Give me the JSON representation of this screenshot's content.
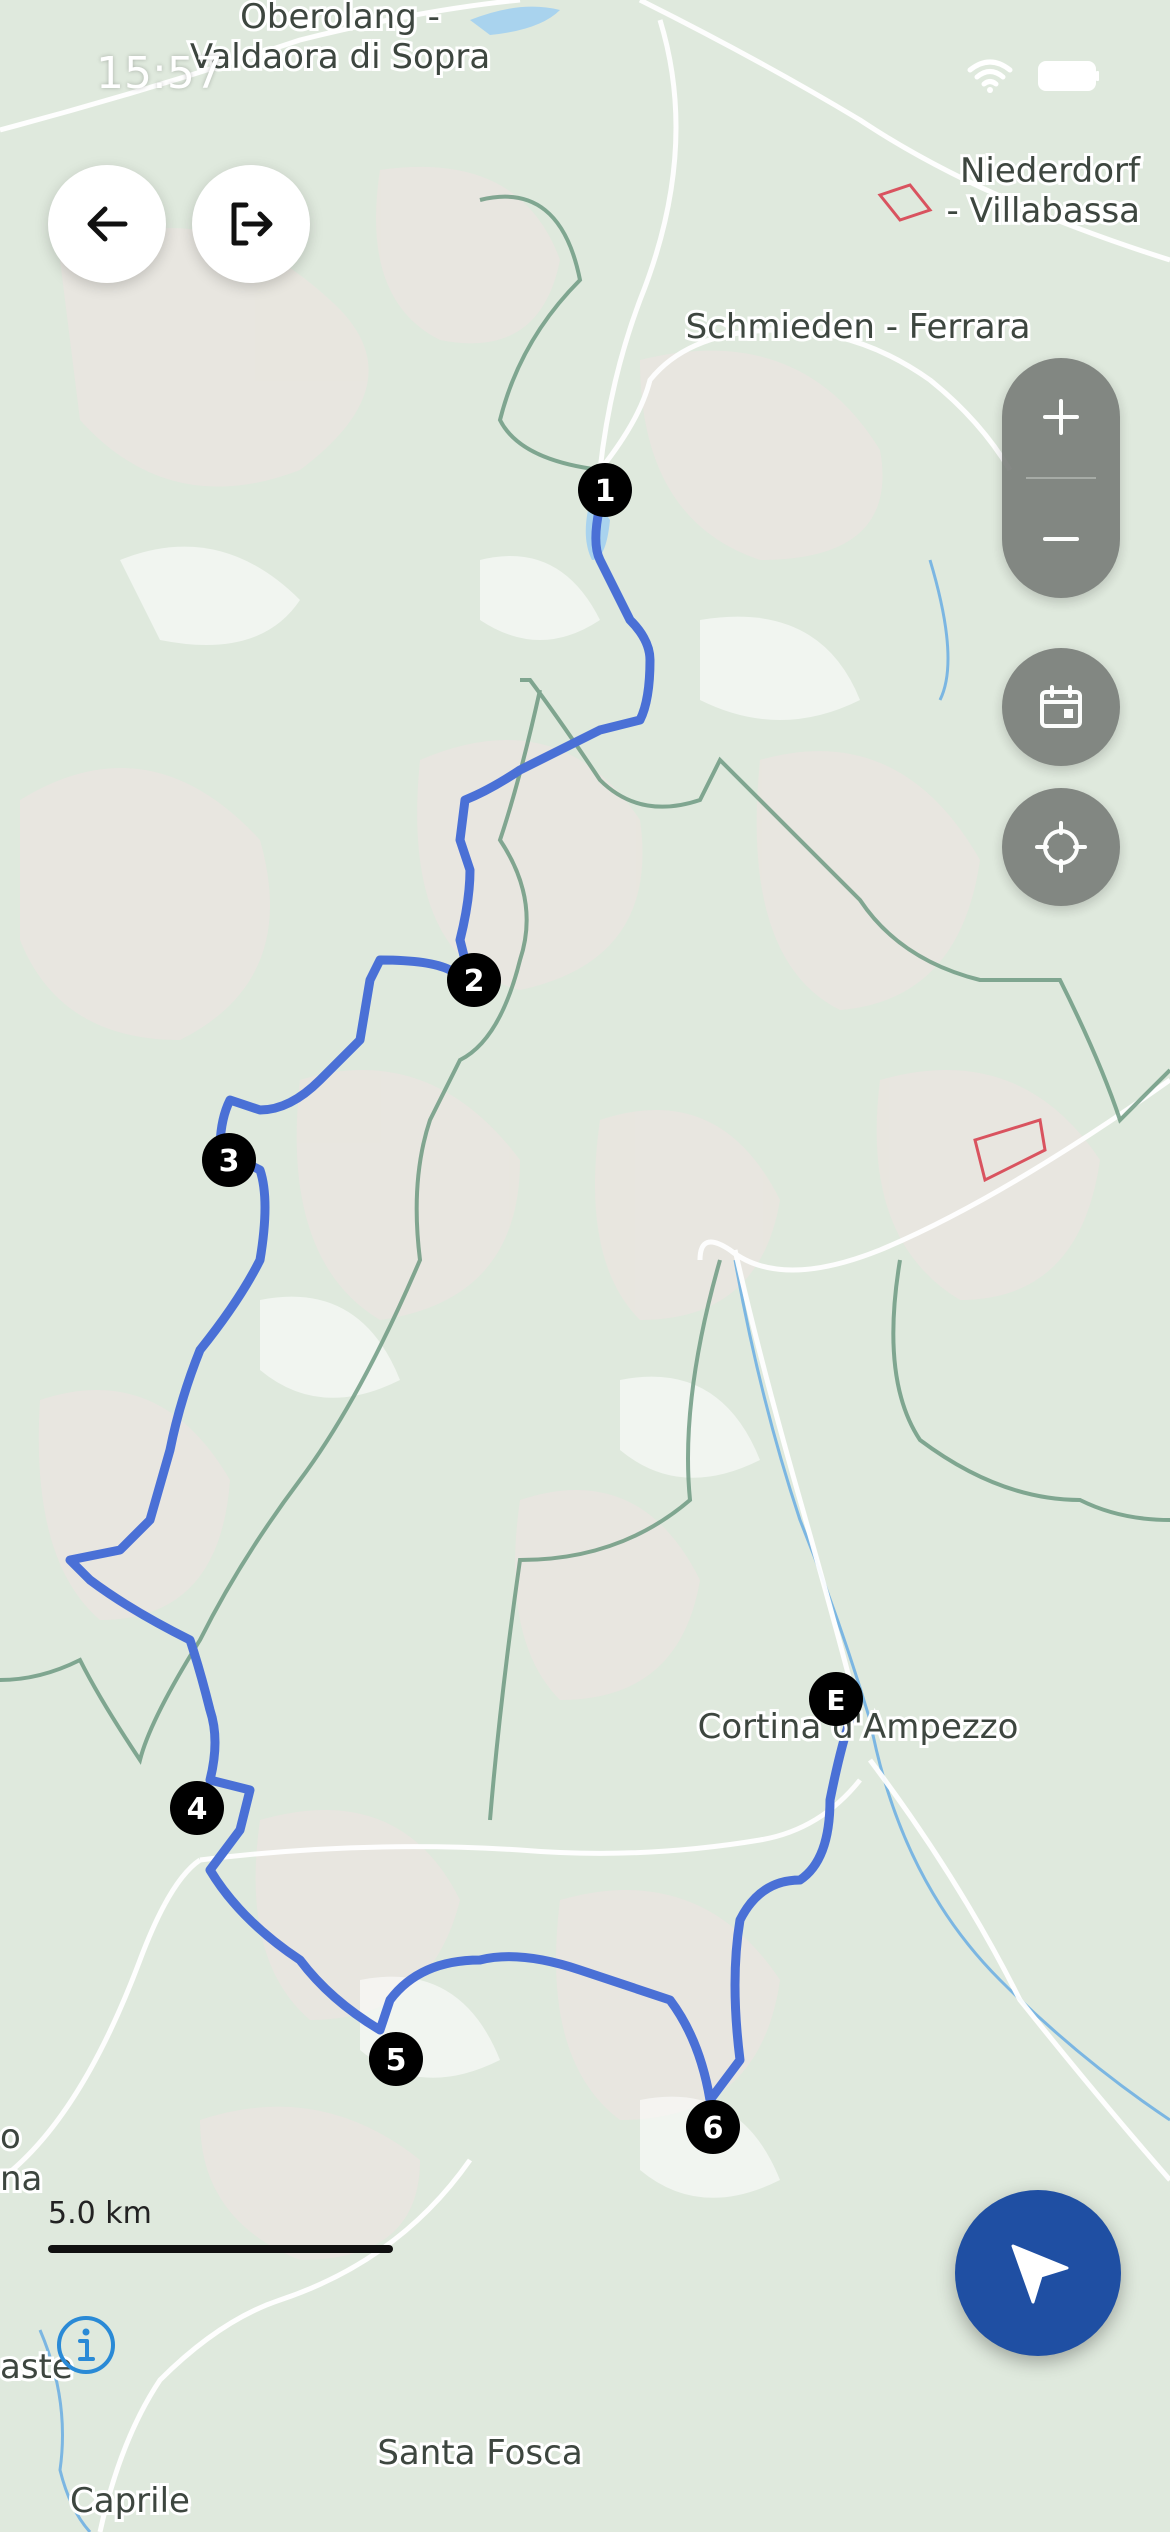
{
  "status_bar": {
    "time": "15:57"
  },
  "map": {
    "place_labels": [
      "Oberolang -",
      "Valdaora di Sopra",
      "Niederdorf",
      "- Villabassa",
      "Schmieden - Ferrara",
      "Cortina d'Ampezzo",
      "Santa Fosca",
      "Caprile",
      "aste",
      "o",
      "na"
    ],
    "route_color": "#4a70d6",
    "markers": [
      "1",
      "2",
      "3",
      "4",
      "5",
      "6",
      "E"
    ]
  },
  "scale": {
    "label": "5.0 km"
  },
  "controls": {
    "back": "arrow-left-icon",
    "exit": "exit-icon",
    "zoom_in": "plus-icon",
    "zoom_out": "minus-icon",
    "calendar": "calendar-icon",
    "locate": "crosshair-icon",
    "navigate": "navigation-arrow-icon",
    "info": "info-icon"
  },
  "colors": {
    "navigate_button": "#1f4fa3",
    "info_icon": "#2a8ad6"
  }
}
